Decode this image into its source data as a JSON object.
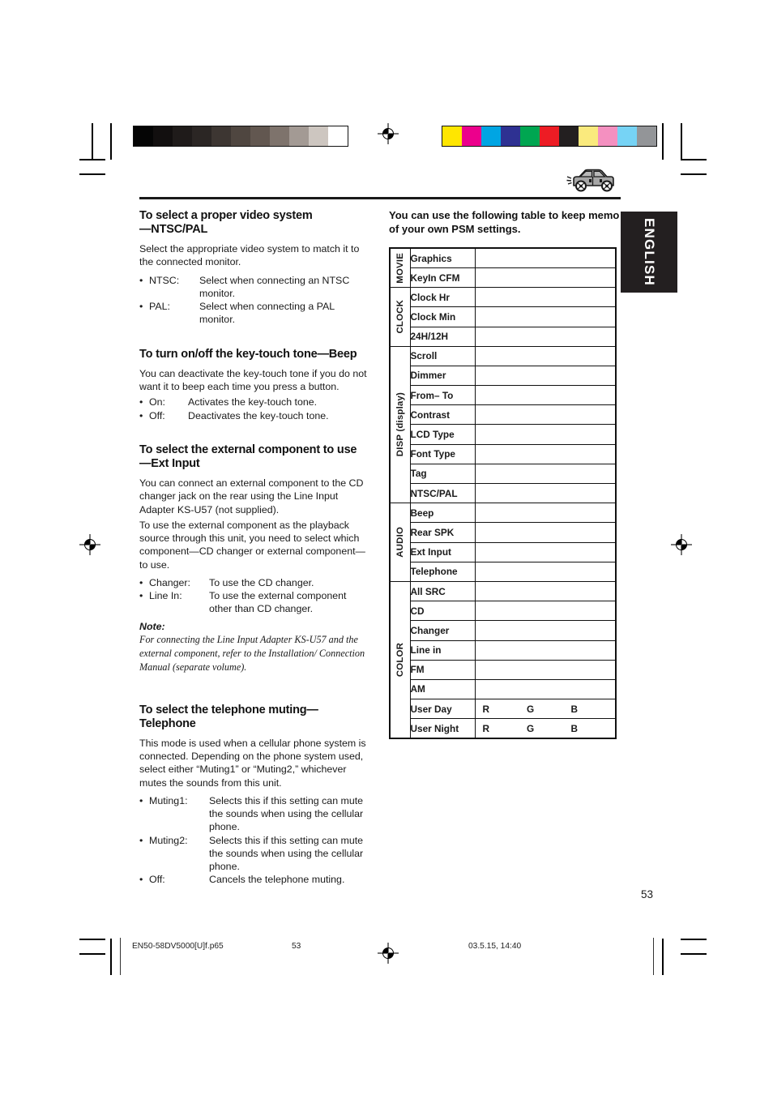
{
  "language_tab": "ENGLISH",
  "page_number": "53",
  "left_column": {
    "sections": [
      {
        "heading_line1": "To select a proper video system",
        "heading_line2": "—NTSC/PAL",
        "paragraphs": [
          "Select the appropriate video system to match it to the connected monitor."
        ],
        "bullets": [
          {
            "term": "NTSC:",
            "desc": "Select when connecting an NTSC monitor."
          },
          {
            "term": "PAL:",
            "desc": "Select when connecting a PAL monitor."
          }
        ]
      },
      {
        "heading_line1": "To turn on/off the key-touch tone—Beep",
        "heading_line2": "",
        "paragraphs": [
          "You can deactivate the key-touch tone if you do not want it to beep each time you press a button."
        ],
        "bullets": [
          {
            "term": "On:",
            "desc": "Activates the key-touch tone."
          },
          {
            "term": "Off:",
            "desc": "Deactivates the key-touch tone."
          }
        ]
      },
      {
        "heading_line1": "To select the external component to use",
        "heading_line2": "—Ext Input",
        "paragraphs": [
          "You can connect an external component to the CD changer jack on the rear using the Line Input Adapter KS-U57 (not supplied).",
          "To use the external component as the playback source through this unit, you need to select which component—CD changer or external component—to use."
        ],
        "bullets": [
          {
            "term": "Changer:",
            "desc": "To use the CD changer."
          },
          {
            "term": "Line In:",
            "desc": "To use the external component other than CD changer."
          }
        ],
        "note_label": "Note:",
        "note_text": "For connecting the Line Input Adapter KS-U57 and the external component, refer to the Installation/ Connection Manual (separate volume)."
      },
      {
        "heading_line1": "To select the telephone muting—",
        "heading_line2": "Telephone",
        "paragraphs": [
          "This mode is used when a cellular phone system is connected. Depending on the phone system used, select either “Muting1” or “Muting2,” whichever mutes the sounds from this unit."
        ],
        "bullets": [
          {
            "term": "Muting1:",
            "desc": "Selects this if this setting can mute the sounds when using the cellular phone."
          },
          {
            "term": "Muting2:",
            "desc": "Selects this if this setting can mute the sounds when using the cellular phone."
          },
          {
            "term": "Off:",
            "desc": "Cancels the telephone muting."
          }
        ]
      }
    ]
  },
  "right_column": {
    "intro": "You can use the following table to keep memo of your own PSM settings.",
    "table": {
      "rgb_labels": [
        "R",
        "G",
        "B"
      ],
      "groups": [
        {
          "name": "MOVIE",
          "items": [
            "Graphics",
            "KeyIn CFM"
          ]
        },
        {
          "name": "CLOCK",
          "items": [
            "Clock Hr",
            "Clock Min",
            "24H/12H"
          ]
        },
        {
          "name": "DISP (display)",
          "items": [
            "Scroll",
            "Dimmer",
            "From– To",
            "Contrast",
            "LCD Type",
            "Font Type",
            "Tag",
            "NTSC/PAL"
          ]
        },
        {
          "name": "AUDIO",
          "items": [
            "Beep",
            "Rear SPK",
            "Ext Input",
            "Telephone"
          ]
        },
        {
          "name": "COLOR",
          "items": [
            "All SRC",
            "CD",
            "Changer",
            "Line in",
            "FM",
            "AM",
            "User Day",
            "User Night"
          ]
        }
      ]
    }
  },
  "footer": {
    "filename": "EN50-58DV5000[U]f.p65",
    "page": "53",
    "timestamp": "03.5.15, 14:40"
  },
  "calibration": {
    "grayscale": [
      "#050505",
      "#120f0f",
      "#1f1b1a",
      "#2b2624",
      "#3d3632",
      "#4f4640",
      "#625750",
      "#7e736c",
      "#a39a94",
      "#cdc6c0",
      "#ffffff"
    ],
    "colors": [
      "#ffe600",
      "#ec008c",
      "#00a5e3",
      "#2e3192",
      "#00a651",
      "#ed1c24",
      "#231f20",
      "#faea7d",
      "#f490c0",
      "#76d3f5",
      "#939598"
    ]
  }
}
